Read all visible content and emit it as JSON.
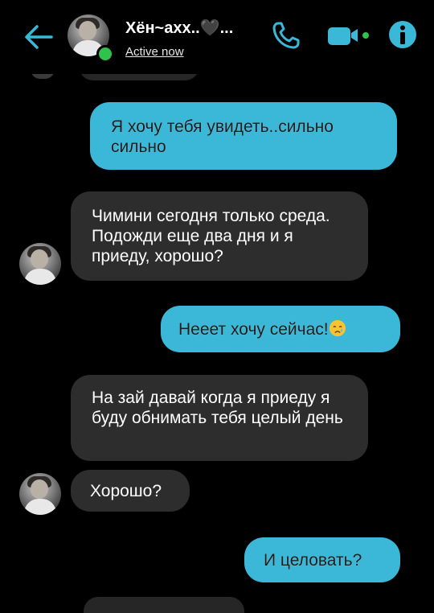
{
  "header": {
    "contact_name": "Хён~ахх..🖤...",
    "status": "Active now",
    "icons": [
      "back-arrow-icon",
      "phone-icon",
      "video-camera-icon",
      "info-icon"
    ],
    "accent_color": "#3bb7d7",
    "online_color": "#31c24d"
  },
  "messages": [
    {
      "direction": "outgoing",
      "text": "Я хочу тебя увидеть..сильно сильно"
    },
    {
      "direction": "incoming",
      "text": "Чимини сегодня только среда. Подожди еще два дня и я приеду, хорошо?"
    },
    {
      "direction": "outgoing",
      "text": "Нееет хочу сейчас!",
      "emoji": "crying-face-emoji"
    },
    {
      "direction": "incoming",
      "text": "На зай давай когда я приеду я буду обнимать тебя целый день"
    },
    {
      "direction": "incoming",
      "text": "Хорошо?"
    },
    {
      "direction": "outgoing",
      "text": "И целовать?"
    }
  ],
  "colors": {
    "outgoing_bubble": "#3bb7d7",
    "incoming_bubble": "#2d2d2d",
    "background": "#000000"
  }
}
